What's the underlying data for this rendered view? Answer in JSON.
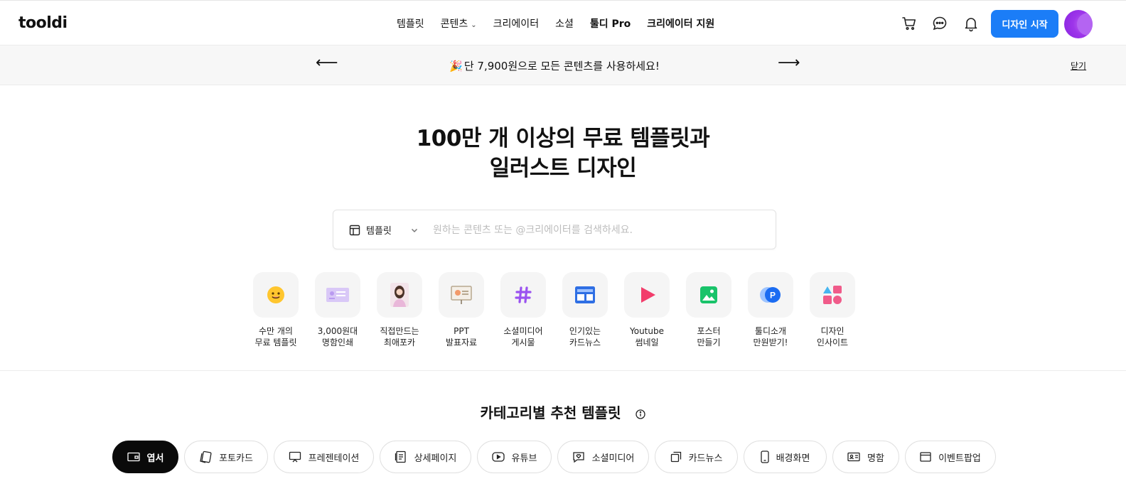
{
  "header": {
    "logo": "tooldi",
    "nav": [
      {
        "label": "템플릿",
        "bold": false
      },
      {
        "label": "콘텐츠",
        "bold": false,
        "dropdown": true
      },
      {
        "label": "크리에이터",
        "bold": false
      },
      {
        "label": "소셜",
        "bold": false
      },
      {
        "label": "툴디 Pro",
        "bold": true
      },
      {
        "label": "크리에이터 지원",
        "bold": true
      }
    ],
    "cta_label": "디자인 시작",
    "icons": [
      "cart-icon",
      "chat-icon",
      "bell-icon"
    ]
  },
  "banner": {
    "message": "단 7,900원으로 모든 콘텐츠를 사용하세요!",
    "close_label": "닫기"
  },
  "hero": {
    "title_line1": "100만 개 이상의 무료 템플릿과",
    "title_line2": "일러스트 디자인"
  },
  "search": {
    "type_label": "템플릿",
    "placeholder": "원하는 콘텐츠 또는 @크리에이터를 검색하세요.",
    "value": ""
  },
  "quick_links": [
    {
      "line1": "수만 개의",
      "line2": "무료 템플릿",
      "icon": "smile-face-icon"
    },
    {
      "line1": "3,000원대",
      "line2": "명함인쇄",
      "icon": "business-card-icon"
    },
    {
      "line1": "직접만드는",
      "line2": "최애포카",
      "icon": "photocard-portrait-icon"
    },
    {
      "line1": "PPT",
      "line2": "발표자료",
      "icon": "presentation-board-icon"
    },
    {
      "line1": "소셜미디어",
      "line2": "게시물",
      "icon": "hashtag-icon"
    },
    {
      "line1": "인기있는",
      "line2": "카드뉴스",
      "icon": "card-news-icon"
    },
    {
      "line1": "Youtube",
      "line2": "썸네일",
      "icon": "play-icon"
    },
    {
      "line1": "포스터",
      "line2": "만들기",
      "icon": "image-poster-icon"
    },
    {
      "line1": "툴디소개",
      "line2": "만원받기!",
      "icon": "p-coin-icon"
    },
    {
      "line1": "디자인",
      "line2": "인사이트",
      "icon": "shapes-icon"
    }
  ],
  "category": {
    "title": "카테고리별 추천 템플릿",
    "chips": [
      {
        "label": "엽서",
        "active": true,
        "icon": "postcard-icon"
      },
      {
        "label": "포토카드",
        "active": false,
        "icon": "photocard-icon"
      },
      {
        "label": "프레젠테이션",
        "active": false,
        "icon": "presentation-icon"
      },
      {
        "label": "상세페이지",
        "active": false,
        "icon": "detail-page-icon"
      },
      {
        "label": "유튜브",
        "active": false,
        "icon": "youtube-icon"
      },
      {
        "label": "소셜미디어",
        "active": false,
        "icon": "social-heart-icon"
      },
      {
        "label": "카드뉴스",
        "active": false,
        "icon": "cards-stack-icon"
      },
      {
        "label": "배경화면",
        "active": false,
        "icon": "phone-icon"
      },
      {
        "label": "명함",
        "active": false,
        "icon": "id-card-icon"
      },
      {
        "label": "이벤트팝업",
        "active": false,
        "icon": "popup-window-icon"
      }
    ]
  },
  "colors": {
    "accent": "#1b7df7",
    "banner_bg": "#f7f7f7",
    "chip_active_bg": "#0a0a0a",
    "avatar": "#9d35ea"
  }
}
